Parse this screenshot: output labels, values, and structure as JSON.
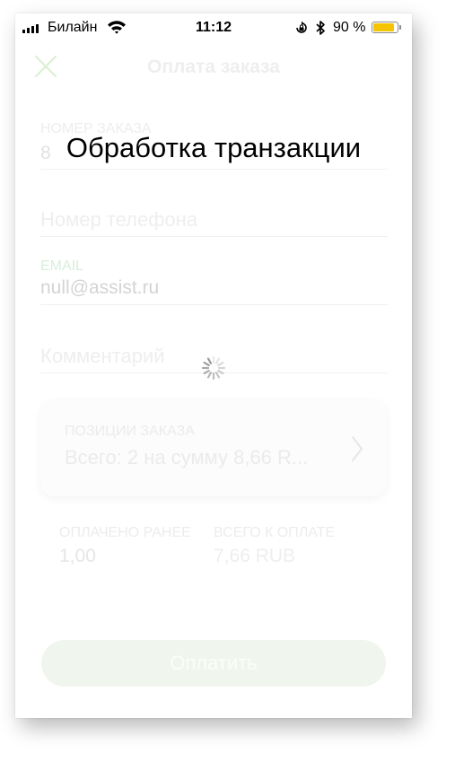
{
  "status_bar": {
    "carrier": "Билайн",
    "time": "11:12",
    "battery": "90 %",
    "battery_level": 0.9,
    "icons": [
      "signal-icon",
      "wifi-icon",
      "orientation-lock-icon",
      "bluetooth-icon",
      "battery-icon"
    ]
  },
  "nav": {
    "title": "Оплата заказа",
    "close_icon": "close-icon"
  },
  "form": {
    "order_number": {
      "label": "НОМЕР ЗАКАЗА",
      "value": "8"
    },
    "phone": {
      "placeholder": "Номер телефона"
    },
    "email": {
      "label": "EMAIL",
      "value": "null@assist.ru"
    },
    "comment": {
      "placeholder": "Комментарий"
    }
  },
  "order_items": {
    "label": "ПОЗИЦИИ ЗАКАЗА",
    "summary": "Всего: 2 на сумму 8,66 R..."
  },
  "totals": {
    "paid_label": "ОПЛАЧЕНО РАНЕЕ",
    "paid_value": "1,00",
    "total_label": "ВСЕГО К ОПЛАТЕ",
    "total_value": "7,66 RUB"
  },
  "pay_button": "Оплатить",
  "overlay": {
    "title": "Обработка транзакции",
    "spinner_icon": "spinner-icon"
  },
  "colors": {
    "accent": "#b8dcaa",
    "battery": "#f5c300",
    "pay_button_bg": "#f0f6ed"
  }
}
